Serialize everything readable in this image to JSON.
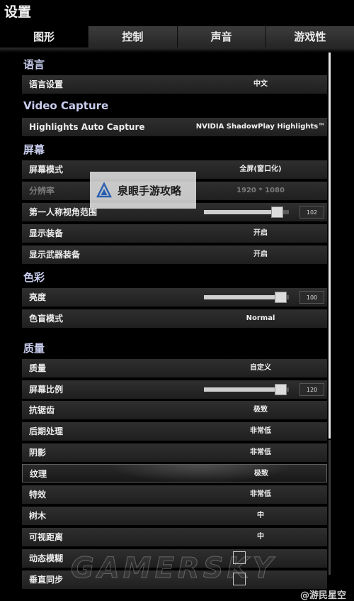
{
  "window": {
    "title": "设置"
  },
  "tabs": [
    {
      "label": "图形",
      "active": true
    },
    {
      "label": "控制",
      "active": false
    },
    {
      "label": "声音",
      "active": false
    },
    {
      "label": "游戏性",
      "active": false
    }
  ],
  "sections": {
    "language": "语言",
    "video_capture": "Video Capture",
    "screen": "屏幕",
    "color": "色彩",
    "quality": "质量"
  },
  "settings": {
    "language": {
      "label": "语言设置",
      "value": "中文"
    },
    "highlights": {
      "label": "Highlights Auto Capture",
      "value": "NVIDIA ShadowPlay Highlights™"
    },
    "display_mode": {
      "label": "屏幕模式",
      "value": "全屏(窗口化)"
    },
    "resolution": {
      "label": "分辨率",
      "value": "1920 * 1080"
    },
    "fov": {
      "label": "第一人称视角范围",
      "value": "102",
      "level": 0.86
    },
    "show_gear": {
      "label": "显示装备",
      "value": "开启"
    },
    "show_weapon_gear": {
      "label": "显示武器装备",
      "value": "开启"
    },
    "brightness": {
      "label": "亮度",
      "value": "100",
      "level": 0.9
    },
    "colorblind": {
      "label": "色盲模式",
      "value": "Normal"
    },
    "quality": {
      "label": "质量",
      "value": "自定义"
    },
    "screen_scale": {
      "label": "屏幕比例",
      "value": "120",
      "level": 0.9
    },
    "antialiasing": {
      "label": "抗锯齿",
      "value": "极致"
    },
    "post_processing": {
      "label": "后期处理",
      "value": "非常低"
    },
    "shadows": {
      "label": "阴影",
      "value": "非常低"
    },
    "textures": {
      "label": "纹理",
      "value": "极致"
    },
    "effects": {
      "label": "特效",
      "value": "非常低"
    },
    "foliage": {
      "label": "树木",
      "value": "中"
    },
    "view_distance": {
      "label": "可视距离",
      "value": "中"
    },
    "motion_blur": {
      "label": "动态模糊",
      "checked": false
    },
    "vsync": {
      "label": "垂直同步",
      "checked": false
    }
  },
  "watermarks": {
    "overlay_text": "泉眼手游攻略",
    "background_text": "GAMERSKY",
    "corner_text": "@游民星空"
  },
  "colors": {
    "section_title": "#c9ceee",
    "row_background": "#2a2a2a",
    "page_background": "#000000"
  }
}
